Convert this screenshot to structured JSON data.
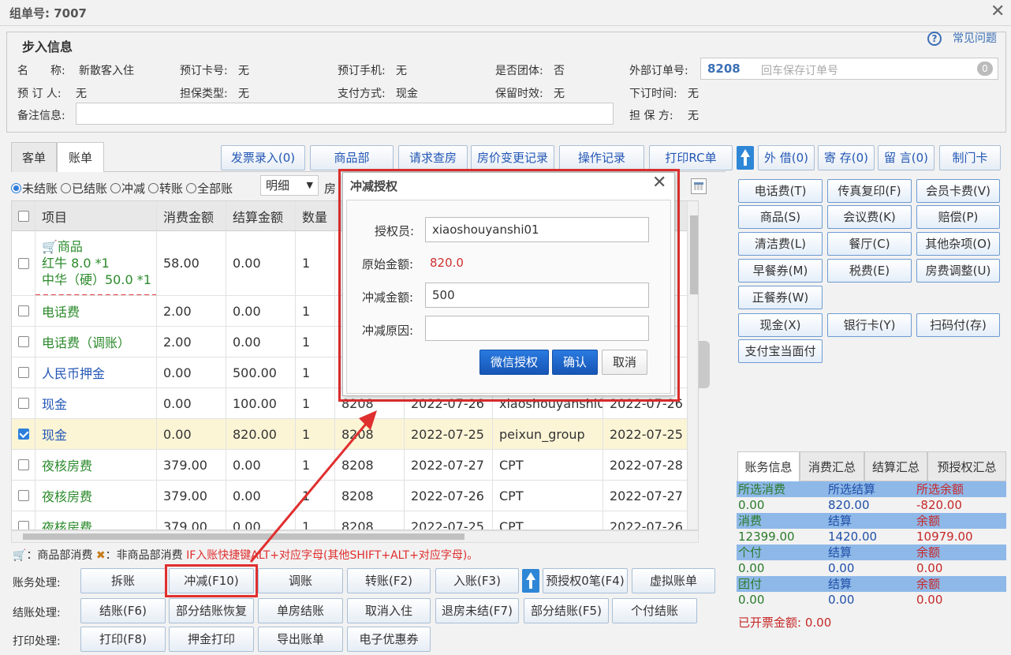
{
  "window": {
    "order_title": "组单号: 7007"
  },
  "help": {
    "label": "常见问题"
  },
  "checkin_info": {
    "legend": "步入信息",
    "name_label": "名　　称:",
    "name_value": "新散客入住",
    "booking_card_label": "预订卡号:",
    "booking_card_value": "无",
    "booking_phone_label": "预订手机:",
    "booking_phone_value": "无",
    "is_group_label": "是否团体:",
    "is_group_value": "否",
    "external_order_label": "外部订单号:",
    "external_order_value": "8208",
    "external_order_placeholder": "回车保存订单号",
    "external_order_count": "0",
    "booker_label": "预 订 人:",
    "booker_value": "无",
    "guarantee_type_label": "担保类型:",
    "guarantee_type_value": "无",
    "payment_label": "支付方式:",
    "payment_value": "现金",
    "retention_label": "保留时效:",
    "retention_value": "无",
    "order_time_label": "下订时间:",
    "order_time_value": "无",
    "remark_label": "备注信息:",
    "guarantor_label": "担 保 方:",
    "guarantor_value": "无"
  },
  "tabs": [
    "客单",
    "账单"
  ],
  "toolbar": {
    "buttons": [
      "发票录入(0)",
      "商品部",
      "请求查房",
      "房价变更记录",
      "操作记录",
      "打印RC单"
    ],
    "buttons_right": [
      "外 借(0)",
      "寄 存(0)",
      "留 言(0)",
      "制门卡"
    ]
  },
  "filters": {
    "options": [
      "未结账",
      "已结账",
      "冲减",
      "转账",
      "全部账"
    ],
    "detail_select": "明细",
    "trailing": "房"
  },
  "table": {
    "headers": [
      "项目",
      "消费金额",
      "结算金额",
      "数量"
    ],
    "rows": [
      {
        "item": "商品",
        "sub1": "红牛 8.0 *1",
        "sub2": "中华（硬）50.0 *1",
        "consume": "58.00",
        "settle": "0.00",
        "qty": "1",
        "room": "",
        "date": "",
        "operator": "",
        "time": "",
        "checked": false
      },
      {
        "item": "电话费",
        "consume": "2.00",
        "settle": "0.00",
        "qty": "1",
        "room": "",
        "date": "",
        "operator": "",
        "time": "",
        "checked": false
      },
      {
        "item": "电话费（调账）",
        "consume": "2.00",
        "settle": "0.00",
        "qty": "1",
        "room": "",
        "date": "",
        "operator": "",
        "time": "",
        "checked": false
      },
      {
        "item": "人民币押金",
        "consume": "0.00",
        "settle": "500.00",
        "qty": "1",
        "room": "",
        "date": "",
        "operator": "",
        "time": "",
        "checked": false
      },
      {
        "item": "现金",
        "consume": "0.00",
        "settle": "100.00",
        "qty": "1",
        "room": "8208",
        "date": "2022-07-26",
        "operator": "xiaoshouyanshi01",
        "time": "2022-07-26 1",
        "checked": false
      },
      {
        "item": "现金",
        "consume": "0.00",
        "settle": "820.00",
        "qty": "1",
        "room": "8208",
        "date": "2022-07-25",
        "operator": "peixun_group",
        "time": "2022-07-25 1",
        "checked": true
      },
      {
        "item": "夜核房费",
        "consume": "379.00",
        "settle": "0.00",
        "qty": "1",
        "room": "8208",
        "date": "2022-07-27",
        "operator": "CPT",
        "time": "2022-07-28 0",
        "checked": false
      },
      {
        "item": "夜核房费",
        "consume": "379.00",
        "settle": "0.00",
        "qty": "1",
        "room": "8208",
        "date": "2022-07-26",
        "operator": "CPT",
        "time": "2022-07-27 0",
        "checked": false
      },
      {
        "item": "夜核房费",
        "consume": "379.00",
        "settle": "0.00",
        "qty": "1",
        "room": "8208",
        "date": "2022-07-25",
        "operator": "CPT",
        "time": "2022-07-26 0",
        "checked": false
      }
    ]
  },
  "legend_note": {
    "goods": "：商品部消费",
    "non_goods": "：非商品部消费",
    "shortcut": "IF入账快捷键ALT+对应字母(其他SHIFT+ALT+对应字母)。"
  },
  "actions": {
    "account_label": "账务处理:",
    "account_buttons": [
      "拆账",
      "冲减(F10)",
      "调账",
      "转账(F2)",
      "入账(F3)",
      "预授权0笔(F4)",
      "虚拟账单"
    ],
    "checkout_label": "结账处理:",
    "checkout_buttons": [
      "结账(F6)",
      "部分结账恢复",
      "单房结账",
      "取消入住",
      "退房未结(F7)",
      "部分结账(F5)",
      "个付结账"
    ],
    "print_label": "打印处理:",
    "print_buttons": [
      "打印(F8)",
      "押金打印",
      "导出账单",
      "电子优惠券"
    ]
  },
  "charge_buttons": [
    "电话费(T)",
    "传真复印(F)",
    "会员卡费(V)",
    "商品(S)",
    "会议费(K)",
    "赔偿(P)",
    "清洁费(L)",
    "餐厅(C)",
    "其他杂项(O)",
    "早餐券(M)",
    "税费(E)",
    "房费调整(U)",
    "正餐券(W)"
  ],
  "payment_buttons": [
    "现金(X)",
    "银行卡(Y)",
    "扫码付(存)",
    "支付宝当面付"
  ],
  "account_tabs": [
    "账务信息",
    "消费汇总",
    "结算汇总",
    "预授权汇总"
  ],
  "account_info": {
    "sel_consume_label": "所选消费",
    "sel_settle_label": "所选结算",
    "sel_balance_label": "所选余额",
    "sel_consume": "0.00",
    "sel_settle": "820.00",
    "sel_balance": "-820.00",
    "consume_label": "消费",
    "settle_label": "结算",
    "balance_label": "余额",
    "consume": "12399.00",
    "settle": "1420.00",
    "balance": "10979.00",
    "personal_label": "个付",
    "personal_settle_label": "结算",
    "personal_balance_label": "余额",
    "personal": "0.00",
    "personal_settle": "0.00",
    "personal_balance": "0.00",
    "group_label": "团付",
    "group_settle_label": "结算",
    "group_balance_label": "余额",
    "group": "0.00",
    "group_settle": "0.00",
    "group_balance": "0.00",
    "invoiced_label": "已开票金额:",
    "invoiced": "0.00"
  },
  "dialog": {
    "title": "冲减授权",
    "authorizer_label": "授权员:",
    "authorizer_value": "xiaoshouyanshi01",
    "original_label": "原始金额:",
    "original_value": "820.0",
    "amount_label": "冲减金额:",
    "amount_value": "500",
    "reason_label": "冲减原因:",
    "reason_value": "",
    "wechat_btn": "微信授权",
    "confirm_btn": "确认",
    "cancel_btn": "取消"
  },
  "colors": {
    "highlight": "#e02f2f",
    "primary": "#1a63c6",
    "selected_row": "#fbf5d6"
  }
}
